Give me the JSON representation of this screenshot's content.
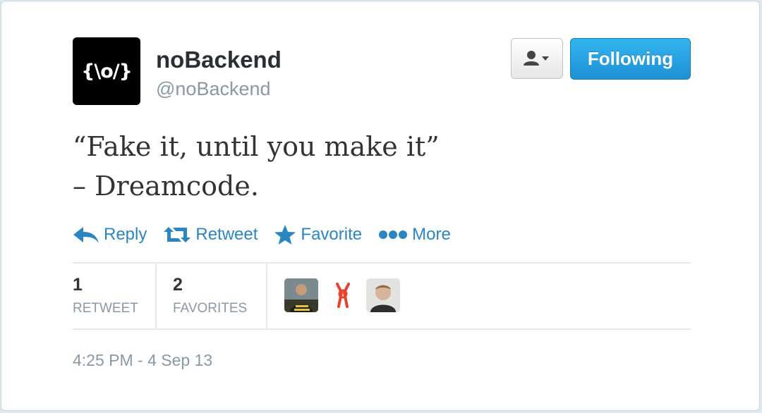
{
  "profile": {
    "avatar_text": "{\\o/}",
    "name": "noBackend",
    "handle": "@noBackend"
  },
  "buttons": {
    "user_menu_icon": "user-dropdown-icon",
    "following_label": "Following"
  },
  "tweet": {
    "line1": "“Fake it, until you make it”",
    "line2": "– Dreamcode."
  },
  "actions": [
    {
      "label": "Reply",
      "icon": "reply-icon"
    },
    {
      "label": "Retweet",
      "icon": "retweet-icon"
    },
    {
      "label": "Favorite",
      "icon": "star-icon"
    },
    {
      "label": "More",
      "icon": "more-dots-icon"
    }
  ],
  "stats": {
    "retweets": {
      "count": "1",
      "label": "RETWEET"
    },
    "favorites": {
      "count": "2",
      "label": "FAVORITES"
    }
  },
  "favoriters": [
    "avatar-person-yellow-shirt",
    "avatar-red-logo",
    "avatar-person-portrait"
  ],
  "timestamp": "4:25 PM - 4 Sep 13",
  "colors": {
    "link": "#2a86c2",
    "following_button": "#1d91d4",
    "muted_text": "#8899a6"
  }
}
